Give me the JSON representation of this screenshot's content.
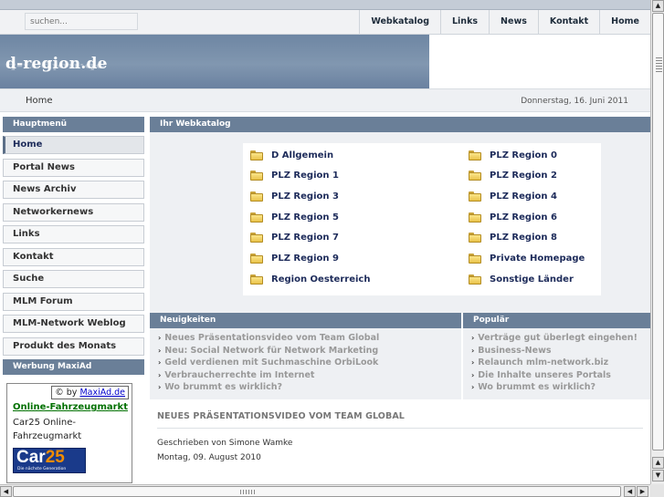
{
  "search": {
    "placeholder": "suchen..."
  },
  "topnav": [
    "Webkatalog",
    "Links",
    "News",
    "Kontakt",
    "Home"
  ],
  "site": {
    "logo": "d-region.de"
  },
  "breadcrumb": "Home",
  "date": "Donnerstag, 16. Juni 2011",
  "sidebar": {
    "menu_title": "Hauptmenü",
    "items": [
      "Home",
      "Portal News",
      "News Archiv",
      "Networkernews",
      "Links",
      "Kontakt",
      "Suche",
      "MLM Forum",
      "MLM-Network Weblog",
      "Produkt des Monats"
    ],
    "ad_title": "Werbung MaxiAd",
    "ad": {
      "by_prefix": "© by",
      "by_link": "MaxiAd.de",
      "title": "Online-Fahrzeugmarkt",
      "desc": "Car25 Online-Fahrzeugmarkt",
      "logo_text": "Car",
      "logo_num": "25",
      "logo_sub": "Die nächste Generation"
    }
  },
  "catalog": {
    "title": "Ihr Webkatalog",
    "left": [
      "D Allgemein",
      "PLZ Region 1",
      "PLZ Region 3",
      "PLZ Region 5",
      "PLZ Region 7",
      "PLZ Region 9",
      "Region Oesterreich"
    ],
    "right": [
      "PLZ Region 0",
      "PLZ Region 2",
      "PLZ Region 4",
      "PLZ Region 6",
      "PLZ Region 8",
      "Private Homepage",
      "Sonstige Länder"
    ]
  },
  "news": {
    "title": "Neuigkeiten",
    "items": [
      "Neues Präsentationsvideo vom Team Global",
      "Neu: Social Network für Network Marketing",
      "Geld verdienen mit Suchmaschine OrbiLook",
      "Verbraucherrechte im Internet",
      "Wo brummt es wirklich?"
    ]
  },
  "popular": {
    "title": "Populär",
    "items": [
      "Verträge gut überlegt eingehen!",
      "Business-News",
      "Relaunch mlm-network.biz",
      "Die Inhalte unseres Portals",
      "Wo brummt es wirklich?"
    ]
  },
  "article": {
    "title": "NEUES PRÄSENTATIONSVIDEO VOM TEAM GLOBAL",
    "author": "Geschrieben von Simone Wamke",
    "date": "Montag, 09. August 2010"
  },
  "colors": {
    "header_blue": "#6e86a3",
    "section_header": "#6a7f98",
    "link_dark": "#1d2b5a"
  }
}
